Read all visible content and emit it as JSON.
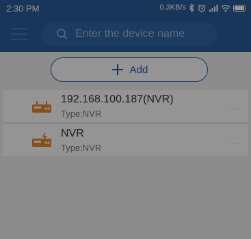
{
  "status_bar": {
    "time": "2:30 PM",
    "speed": "0.3KB/s"
  },
  "header": {
    "search": {
      "placeholder": "Enter the device name"
    }
  },
  "add_button": {
    "label": "Add"
  },
  "devices": [
    {
      "name": "192.168.100.187(NVR)",
      "type": "Type:NVR",
      "more": "···"
    },
    {
      "name": "NVR",
      "type": "Type:NVR",
      "more": "···"
    }
  ],
  "colors": {
    "header_blue": "#2a5e9c",
    "device_icon_orange": "#e8892d",
    "overlay": "rgba(0,0,0,0.42)"
  },
  "icons": {
    "status": [
      "bluetooth-icon",
      "alarm-icon",
      "signal-icon",
      "wifi-icon",
      "battery-icon"
    ],
    "header": [
      "menu-icon",
      "search-icon"
    ],
    "rows": [
      "nvr-device-icon",
      "more-icon"
    ]
  }
}
